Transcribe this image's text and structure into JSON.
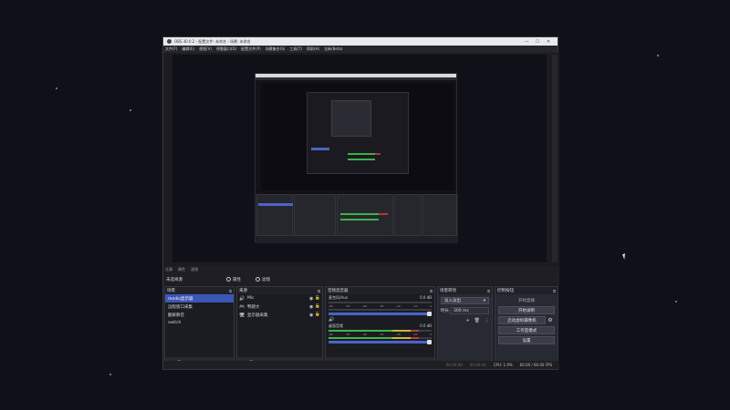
{
  "window": {
    "title": "OBS 30.0.2 - 配置文件: 未命名 - 场景: 未命名",
    "controls": [
      "—",
      "☐",
      "✕"
    ]
  },
  "menu": [
    "文件(F)",
    "编辑(E)",
    "视图(V)",
    "停靠窗口(D)",
    "配置文件(P)",
    "场景集合(S)",
    "工具(T)",
    "帮助(H)",
    "全新(Beta)"
  ],
  "source_toolbar": {
    "source_type": "无源",
    "properties_label": "属性",
    "filters_label": "滤镜"
  },
  "scene_strip": {
    "current_source": "未选择源",
    "properties_label": "属性",
    "filters_label": "滤镜"
  },
  "docks": {
    "scenes": {
      "title": "场景",
      "items": [
        "media显示器",
        "远程窗口采集",
        "翻屏静音",
        "switch"
      ],
      "footer": [
        "+",
        "🗑",
        "⧉",
        "∧",
        "∨"
      ]
    },
    "sources": {
      "title": "来源",
      "items": [
        {
          "icon": "🔊",
          "label": "Mic"
        },
        {
          "icon": "🎮",
          "label": "鸭刚大"
        },
        {
          "icon": "🖥",
          "label": "显示器采集"
        }
      ],
      "footer": [
        "+",
        "🗑",
        "⚙",
        "∧",
        "∨"
      ]
    },
    "mixer": {
      "title": "音频混音器",
      "tracks": [
        {
          "name": "麦克风/Aux",
          "db": "0.0 dB",
          "fill": 0.0
        },
        {
          "name": "桌面音频",
          "db": "0.0 dB",
          "fill": 0.62
        }
      ],
      "ticks": [
        "-60",
        "-55",
        "-50",
        "-45",
        "-40",
        "-35",
        "-30",
        "-25",
        "-20",
        "-15",
        "-10",
        "-5",
        "0"
      ],
      "footer": [
        "⚙",
        "⋮"
      ]
    },
    "transitions": {
      "title": "场景转场",
      "selected": "淡入淡出",
      "duration_label": "时长",
      "duration_value": "300 ms",
      "buttons": [
        "+",
        "🗑",
        "⋮"
      ]
    },
    "controls": {
      "title": "控制按钮",
      "buttons": [
        "开始直播",
        "开始录制",
        "启动虚拟摄像机",
        "工作室模式",
        "设置",
        "退出"
      ]
    }
  },
  "status": {
    "live": "00:00:00",
    "rec": "00:00:00",
    "cpu": "CPU: 1.9%",
    "fps": "60.00 / 60.00 FPS"
  }
}
